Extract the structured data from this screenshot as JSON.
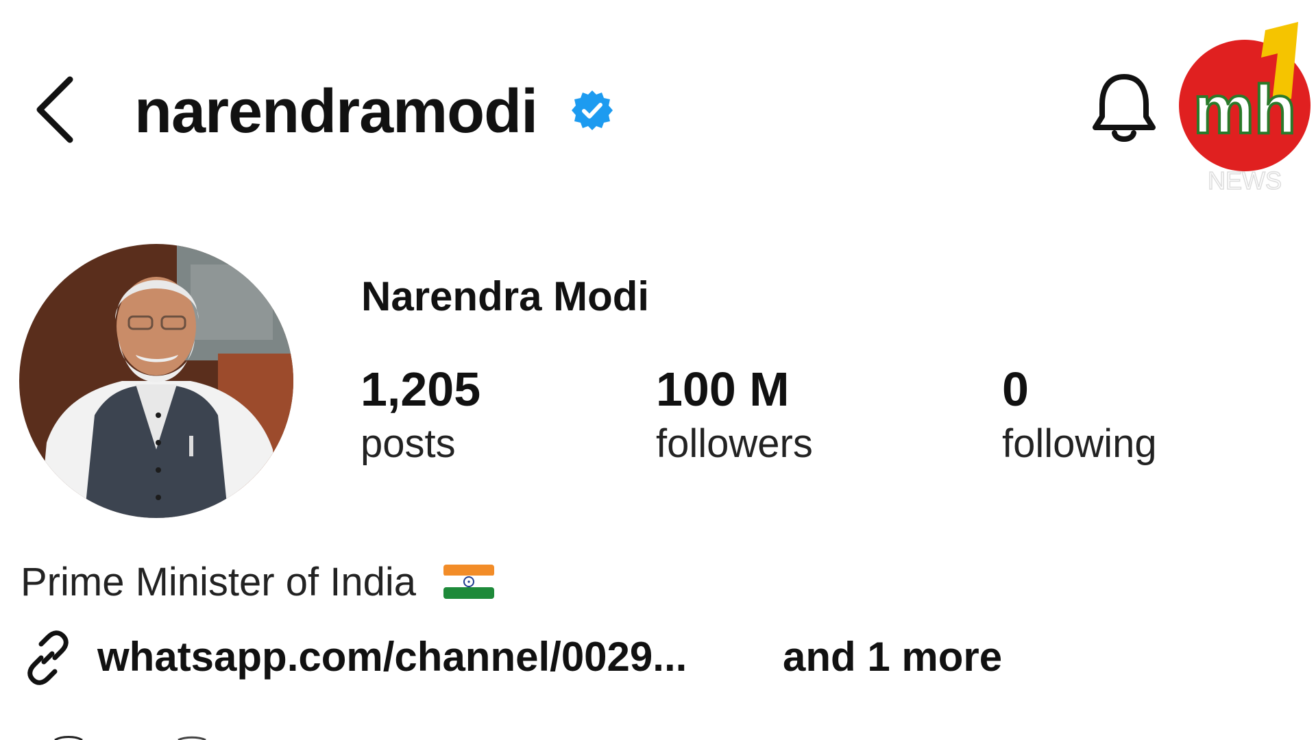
{
  "header": {
    "username": "narendramodi",
    "back_icon": "chevron-left-icon",
    "verified_icon": "verified-badge-icon",
    "bell_icon": "bell-icon",
    "logo": {
      "icon": "mh1-news-logo",
      "text": "mh",
      "numeral": "1",
      "caption": "NEWS"
    }
  },
  "profile": {
    "display_name": "Narendra Modi",
    "avatar_icon": "profile-photo",
    "stats": [
      {
        "count": "1,205",
        "label": "posts"
      },
      {
        "count": "100 M",
        "label": "followers"
      },
      {
        "count": "0",
        "label": "following"
      }
    ],
    "bio": "Prime Minister of India",
    "bio_emoji": "india-flag-icon",
    "link": {
      "icon": "link-icon",
      "text": "whatsapp.com/channel/0029...",
      "more": "and 1 more"
    }
  },
  "colors": {
    "verified_blue": "#1d9bf0",
    "text": "#111111",
    "background": "#ffffff",
    "logo_red": "#e02020",
    "logo_yellow": "#f5c400"
  }
}
